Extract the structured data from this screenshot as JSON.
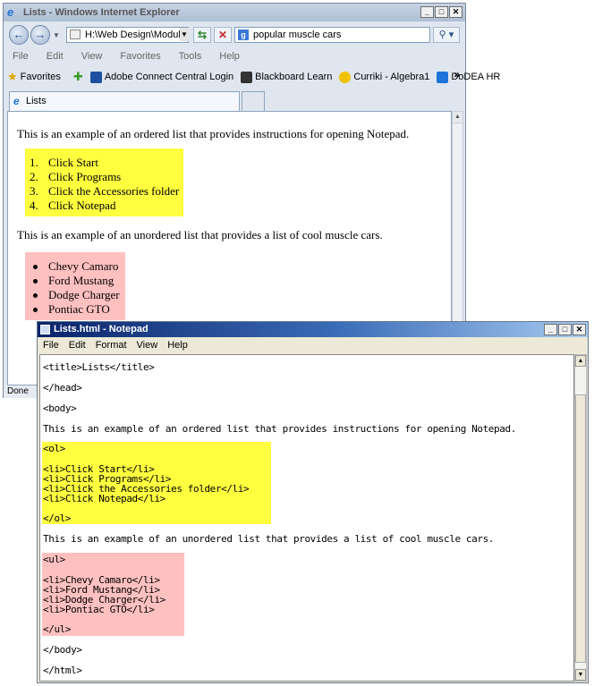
{
  "ie": {
    "title": "Lists - Windows Internet Explorer",
    "address": "H:\\Web Design\\Module :",
    "search_query": "popular muscle cars",
    "menu": [
      "File",
      "Edit",
      "View",
      "Favorites",
      "Tools",
      "Help"
    ],
    "favorites_label": "Favorites",
    "favorites": [
      {
        "label": "Adobe Connect Central Login",
        "color": "#1e4fa0"
      },
      {
        "label": "Blackboard Learn",
        "color": "#333333"
      },
      {
        "label": "Curriki - Algebra1",
        "color": "#f2c200"
      },
      {
        "label": "DoDEA HR",
        "color": "#1e73d8"
      }
    ],
    "more_chevron": "»",
    "tab_label": "Lists",
    "status": "Done",
    "page": {
      "ordered_intro": "This is an example of an ordered list that provides instructions for opening Notepad.",
      "ordered_items": [
        "Click Start",
        "Click Programs",
        "Click the Accessories folder",
        "Click Notepad"
      ],
      "ordered_numbers": [
        "1.",
        "2.",
        "3.",
        "4."
      ],
      "unordered_intro": "This is an example of an unordered list that provides a list of cool muscle cars.",
      "unordered_items": [
        "Chevy Camaro",
        "Ford Mustang",
        "Dodge Charger",
        "Pontiac GTO"
      ]
    }
  },
  "notepad": {
    "title": "Lists.html - Notepad",
    "menu": [
      "File",
      "Edit",
      "Format",
      "View",
      "Help"
    ],
    "lines": [
      "<title>Lists</title>",
      "</head>",
      "<body>",
      "This is an example of an ordered list that provides instructions for opening Notepad.",
      "<ol>",
      "<li>Click Start</li>",
      "<li>Click Programs</li>",
      "<li>Click the Accessories folder</li>",
      "<li>Click Notepad</li>",
      "</ol>",
      "This is an example of an unordered list that provides a list of cool muscle cars.",
      "<ul>",
      "<li>Chevy Camaro</li>",
      "<li>Ford Mustang</li>",
      "<li>Dodge Charger</li>",
      "<li>Pontiac GTO</li>",
      "</ul>",
      "</body>",
      "</html>"
    ]
  },
  "colors": {
    "ordered_highlight": "#ffff40",
    "unordered_highlight": "#ffc0c0"
  }
}
